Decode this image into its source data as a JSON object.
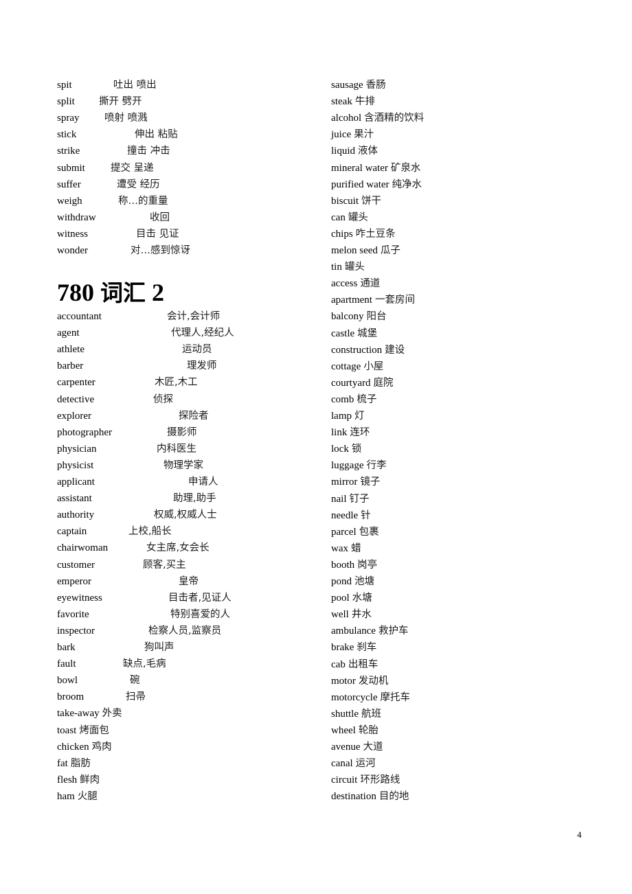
{
  "document": {
    "page_number": "4",
    "section_heading": {
      "number": "780",
      "title_cjk": "词汇",
      "suffix": "2"
    },
    "left_column_top": [
      {
        "en": "spit",
        "zh": "吐出  喷出"
      },
      {
        "en": "split",
        "zh": "撕开  劈开"
      },
      {
        "en": "spray",
        "zh": "喷射  喷溅"
      },
      {
        "en": "stick",
        "zh": "伸出  粘贴"
      },
      {
        "en": "strike",
        "zh": "撞击  冲击"
      },
      {
        "en": "submit",
        "zh": "提交  呈递"
      },
      {
        "en": "suffer",
        "zh": "遭受  经历"
      },
      {
        "en": "weigh",
        "zh": "称…的重量"
      },
      {
        "en": "withdraw",
        "zh": "收回"
      },
      {
        "en": "witness",
        "zh": "目击  见证"
      },
      {
        "en": "wonder",
        "zh": "对…感到惊讶"
      }
    ],
    "left_column_section": [
      {
        "en": "accountant",
        "zh": "会计,会计师"
      },
      {
        "en": "agent",
        "zh": "代理人,经纪人"
      },
      {
        "en": "athlete",
        "zh": "运动员"
      },
      {
        "en": "barber",
        "zh": "理发师"
      },
      {
        "en": "carpenter",
        "zh": "木匠,木工"
      },
      {
        "en": "detective",
        "zh": "侦探"
      },
      {
        "en": "explorer",
        "zh": "探险者"
      },
      {
        "en": "photographer",
        "zh": "摄影师"
      },
      {
        "en": "physician",
        "zh": "内科医生"
      },
      {
        "en": "physicist",
        "zh": "物理学家"
      },
      {
        "en": "applicant",
        "zh": "申请人"
      },
      {
        "en": "assistant",
        "zh": "助理,助手"
      },
      {
        "en": "authority",
        "zh": "权威,权威人士"
      },
      {
        "en": "captain",
        "zh": "上校,船长"
      },
      {
        "en": "chairwoman",
        "zh": "女主席,女会长"
      },
      {
        "en": "customer",
        "zh": "顾客,买主"
      },
      {
        "en": "emperor",
        "zh": "皇帝"
      },
      {
        "en": "eyewitness",
        "zh": "目击者,见证人"
      },
      {
        "en": "favorite",
        "zh": "特别喜爱的人"
      },
      {
        "en": "inspector",
        "zh": "检察人员,监察员"
      },
      {
        "en": "bark",
        "zh": "狗叫声"
      },
      {
        "en": "fault",
        "zh": "缺点,毛病"
      },
      {
        "en": "bowl",
        "zh": "碗"
      },
      {
        "en": "broom",
        "zh": "扫帚"
      },
      {
        "en": "take-away",
        "zh": "外卖"
      },
      {
        "en": "toast",
        "zh": "烤面包"
      },
      {
        "en": "chicken",
        "zh": "鸡肉"
      },
      {
        "en": "fat",
        "zh": "脂肪"
      },
      {
        "en": "flesh",
        "zh": "鲜肉"
      },
      {
        "en": "ham",
        "zh": "火腿"
      }
    ],
    "right_column": [
      {
        "en": "sausage",
        "zh": "香肠"
      },
      {
        "en": "steak",
        "zh": "牛排"
      },
      {
        "en": "alcohol",
        "zh": "含酒精的饮料"
      },
      {
        "en": "juice",
        "zh": "果汁"
      },
      {
        "en": "liquid",
        "zh": "液体"
      },
      {
        "en": "mineral water",
        "zh": "矿泉水"
      },
      {
        "en": "purified water",
        "zh": "纯净水"
      },
      {
        "en": "biscuit",
        "zh": "饼干"
      },
      {
        "en": "can",
        "zh": "罐头"
      },
      {
        "en": "chips",
        "zh": "咋土豆条"
      },
      {
        "en": "melon seed",
        "zh": "瓜子"
      },
      {
        "en": "tin",
        "zh": "罐头"
      },
      {
        "en": "access",
        "zh": "通道"
      },
      {
        "en": "apartment",
        "zh": "一套房间"
      },
      {
        "en": "balcony",
        "zh": "阳台"
      },
      {
        "en": "castle",
        "zh": "城堡"
      },
      {
        "en": "construction",
        "zh": "建设"
      },
      {
        "en": "cottage",
        "zh": "小屋"
      },
      {
        "en": "courtyard",
        "zh": "庭院"
      },
      {
        "en": "comb",
        "zh": "梳子"
      },
      {
        "en": "lamp",
        "zh": "灯"
      },
      {
        "en": "link",
        "zh": "连环"
      },
      {
        "en": "lock",
        "zh": "锁"
      },
      {
        "en": "luggage",
        "zh": "行李"
      },
      {
        "en": "mirror",
        "zh": "镜子"
      },
      {
        "en": "nail",
        "zh": "钉子"
      },
      {
        "en": "needle",
        "zh": "针"
      },
      {
        "en": "parcel",
        "zh": "包裹"
      },
      {
        "en": "wax",
        "zh": "蜡"
      },
      {
        "en": "booth",
        "zh": "岗亭"
      },
      {
        "en": "pond",
        "zh": "池塘"
      },
      {
        "en": "pool",
        "zh": "水塘"
      },
      {
        "en": "well",
        "zh": "井水"
      },
      {
        "en": "ambulance",
        "zh": "救护车"
      },
      {
        "en": "brake",
        "zh": "刹车"
      },
      {
        "en": "cab",
        "zh": "出租车"
      },
      {
        "en": "motor",
        "zh": "发动机"
      },
      {
        "en": "motorcycle",
        "zh": "摩托车"
      },
      {
        "en": "shuttle",
        "zh": "航班"
      },
      {
        "en": "wheel",
        "zh": "轮胎"
      },
      {
        "en": "avenue",
        "zh": "大道"
      },
      {
        "en": "canal",
        "zh": "运河"
      },
      {
        "en": "circuit",
        "zh": "环形路线"
      },
      {
        "en": "destination",
        "zh": "目的地"
      }
    ]
  }
}
